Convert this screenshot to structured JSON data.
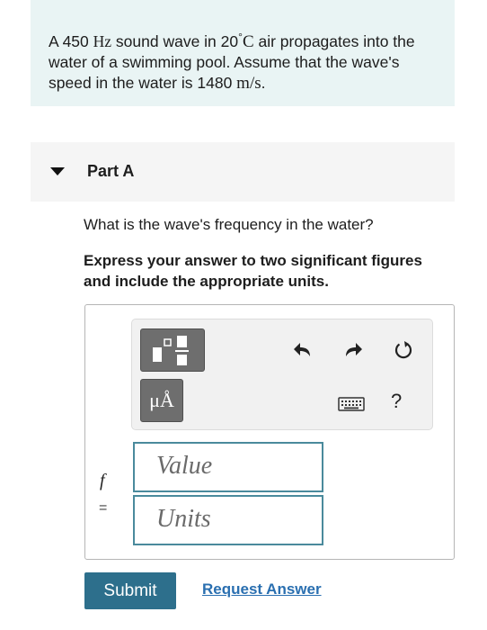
{
  "problem": {
    "text_1": "A 450 ",
    "unit_hz": "Hz",
    "text_2": " sound wave in 20",
    "degree": "°",
    "unit_c": "C",
    "text_3": " air propagates into the water of a swimming pool. Assume that the wave's speed in the water is 1480 ",
    "unit_ms": "m/s",
    "text_4": "."
  },
  "part": {
    "title": "Part A"
  },
  "question": "What is the wave's frequency in the water?",
  "instruction": "Express your answer to two significant figures and include the appropriate units.",
  "toolbar": {
    "templates_icon": "templates-icon",
    "units_label": "μÅ",
    "undo_icon": "undo-icon",
    "redo_icon": "redo-icon",
    "reset_icon": "reset-icon",
    "keyboard_icon": "keyboard-icon",
    "help_label": "?"
  },
  "answer": {
    "variable": "f",
    "equals": "=",
    "value_placeholder": "Value",
    "units_placeholder": "Units"
  },
  "actions": {
    "submit_label": "Submit",
    "request_label": "Request Answer"
  },
  "colors": {
    "problem_bg": "#e9f4f4",
    "submit_bg": "#2d6f8c",
    "link": "#2a6fb0",
    "field_border": "#4a8a9c"
  }
}
